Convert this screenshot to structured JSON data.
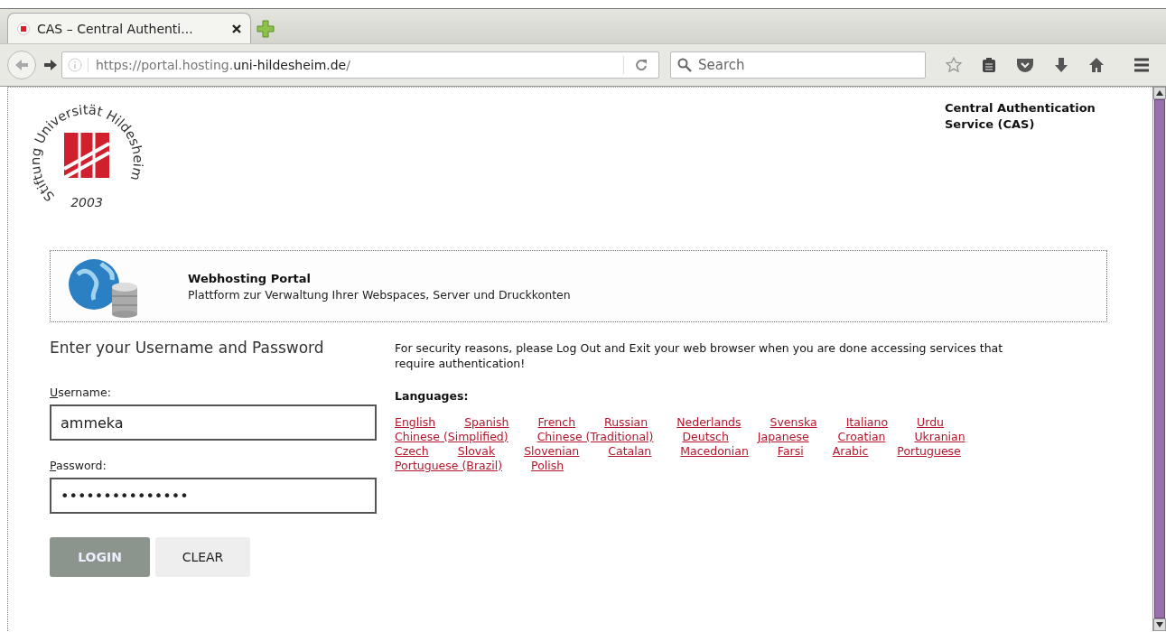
{
  "browser": {
    "tab": {
      "title": "CAS – Central Authenti...",
      "selected": true
    },
    "url": {
      "host_prefix": "https://portal.hosting.",
      "domain": "uni-hildesheim.de",
      "path": "/"
    },
    "search": {
      "placeholder": "Search"
    }
  },
  "header": {
    "logo": {
      "ring_text": "Stiftung Universität Hildesheim",
      "year": "2003"
    },
    "service_title": "Central Authentication Service (CAS)"
  },
  "banner": {
    "title": "Webhosting Portal",
    "subtitle": "Plattform zur Verwaltung Ihrer Webspaces, Server und Druckkonten"
  },
  "login": {
    "heading": "Enter your Username and Password",
    "username": {
      "label": "Username:",
      "value": "ammeka"
    },
    "password": {
      "label": "Password:",
      "value": "•••••••••••••••"
    },
    "buttons": [
      {
        "label": "LOGIN",
        "kind": "primary"
      },
      {
        "label": "CLEAR",
        "kind": "secondary"
      }
    ]
  },
  "notice": "For security reasons, please Log Out and Exit your web browser when you are done accessing services that require authentication!",
  "languages": {
    "heading": "Languages:",
    "links": [
      "English",
      "Spanish",
      "French",
      "Russian",
      "Nederlands",
      "Svenska",
      "Italiano",
      "Urdu",
      "Chinese (Simplified)",
      "Chinese (Traditional)",
      "Deutsch",
      "Japanese",
      "Croatian",
      "Ukranian",
      "Czech",
      "Slovak",
      "Slovenian",
      "Catalan",
      "Macedonian",
      "Farsi",
      "Arabic",
      "Portuguese",
      "Portuguese (Brazil)",
      "Polish"
    ]
  }
}
